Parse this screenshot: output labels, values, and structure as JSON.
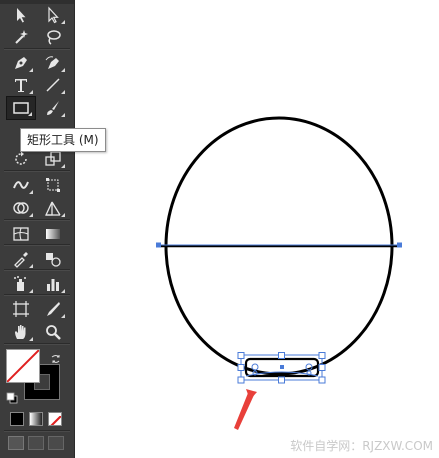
{
  "toolbar": {
    "tools": [
      {
        "name": "selection-tool",
        "icon": "arrow-icon"
      },
      {
        "name": "direct-selection-tool",
        "icon": "white-arrow-icon"
      },
      {
        "name": "magic-wand-tool",
        "icon": "magic-wand-icon"
      },
      {
        "name": "lasso-tool",
        "icon": "lasso-icon"
      },
      {
        "name": "pen-tool",
        "icon": "pen-icon"
      },
      {
        "name": "curvature-tool",
        "icon": "curvature-pen-icon"
      },
      {
        "name": "type-tool",
        "icon": "type-icon"
      },
      {
        "name": "line-tool",
        "icon": "line-icon"
      },
      {
        "name": "rectangle-tool",
        "icon": "rectangle-icon"
      },
      {
        "name": "paintbrush-tool",
        "icon": "brush-icon"
      },
      {
        "name": "rotate-tool",
        "icon": "rotate-icon"
      },
      {
        "name": "scale-tool",
        "icon": "scale-icon"
      },
      {
        "name": "width-tool",
        "icon": "width-icon"
      },
      {
        "name": "free-transform-tool",
        "icon": "free-transform-icon"
      },
      {
        "name": "shape-builder-tool",
        "icon": "shape-builder-icon"
      },
      {
        "name": "perspective-grid-tool",
        "icon": "perspective-icon"
      },
      {
        "name": "mesh-tool",
        "icon": "mesh-icon"
      },
      {
        "name": "gradient-tool",
        "icon": "gradient-icon"
      },
      {
        "name": "eyedropper-tool",
        "icon": "eyedropper-icon"
      },
      {
        "name": "blend-tool",
        "icon": "blend-icon"
      },
      {
        "name": "symbol-sprayer-tool",
        "icon": "sprayer-icon"
      },
      {
        "name": "graph-tool",
        "icon": "graph-icon"
      },
      {
        "name": "artboard-tool",
        "icon": "artboard-icon"
      },
      {
        "name": "slice-tool",
        "icon": "slice-icon"
      },
      {
        "name": "hand-tool",
        "icon": "hand-icon"
      },
      {
        "name": "zoom-tool",
        "icon": "zoom-icon"
      }
    ],
    "tooltip": "矩形工具 (M)",
    "colors": {
      "fill": "#ffffff",
      "stroke": "#000000",
      "none_slash": "#e02020"
    }
  },
  "canvas": {
    "accent": "#4a7bd8",
    "arrow_color": "#e8403a"
  },
  "watermark": "软件自学网：RJZXW.COM"
}
